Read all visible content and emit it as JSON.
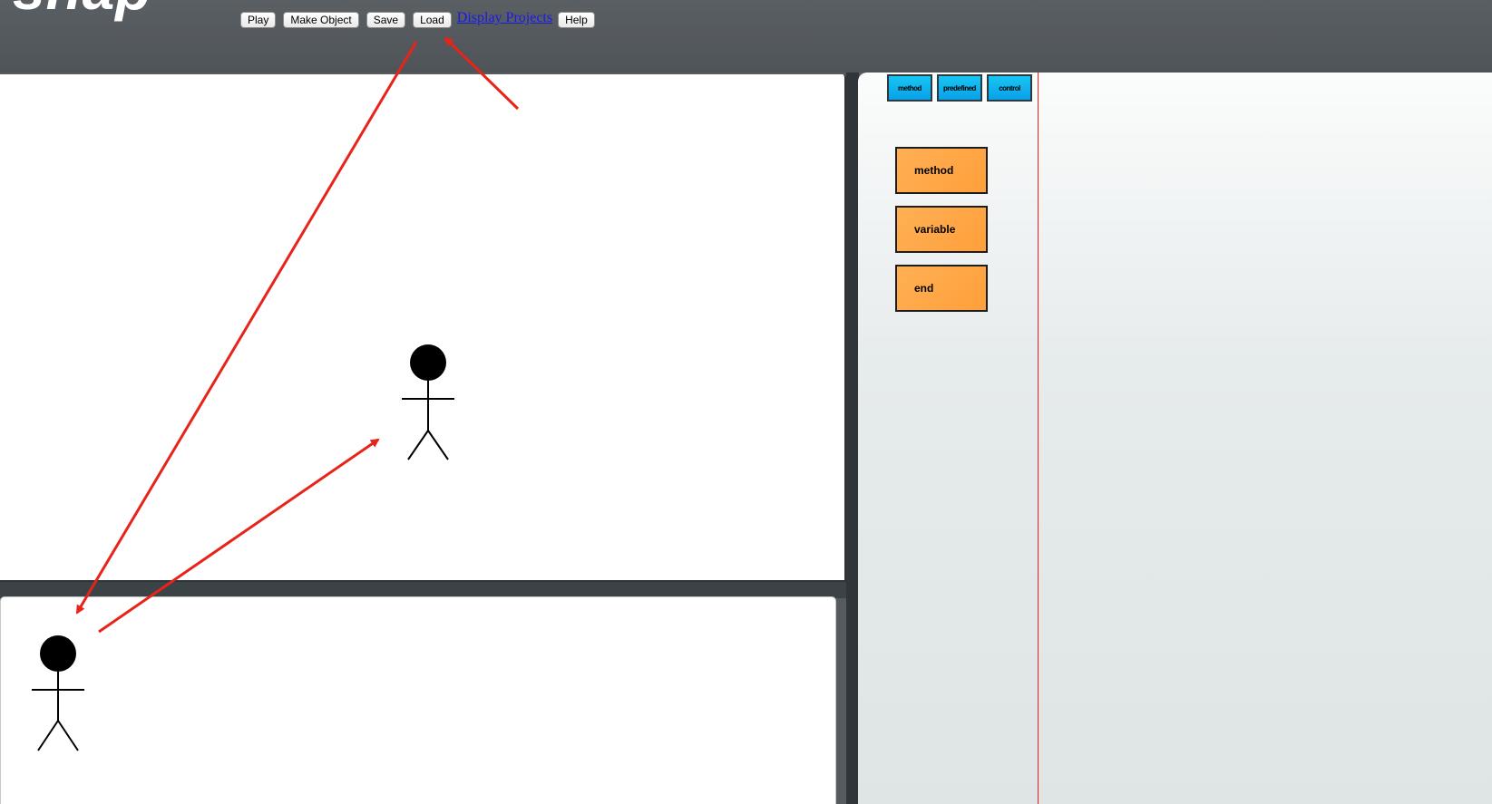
{
  "header": {
    "logo_text": "snap"
  },
  "toolbar": {
    "buttons": [
      {
        "label": "Play"
      },
      {
        "label": "Make Object"
      },
      {
        "label": "Save"
      },
      {
        "label": "Load"
      }
    ],
    "link_label": "Display Projects",
    "help_label": "Help"
  },
  "palette": {
    "categories": [
      {
        "label": "method"
      },
      {
        "label": "predefined"
      },
      {
        "label": "control"
      }
    ],
    "blocks": [
      {
        "label": "method"
      },
      {
        "label": "variable"
      },
      {
        "label": "end"
      }
    ]
  },
  "colors": {
    "header_bg": "#565b5f",
    "category_tab": "#0ab4ee",
    "block": "#ffa347",
    "annotation_arrow": "#e8231a",
    "palette_divider": "#ff1a1a"
  },
  "icons": {
    "stage_sprite": "stick-figure-icon",
    "sprite_thumbnail": "stick-figure-icon"
  }
}
